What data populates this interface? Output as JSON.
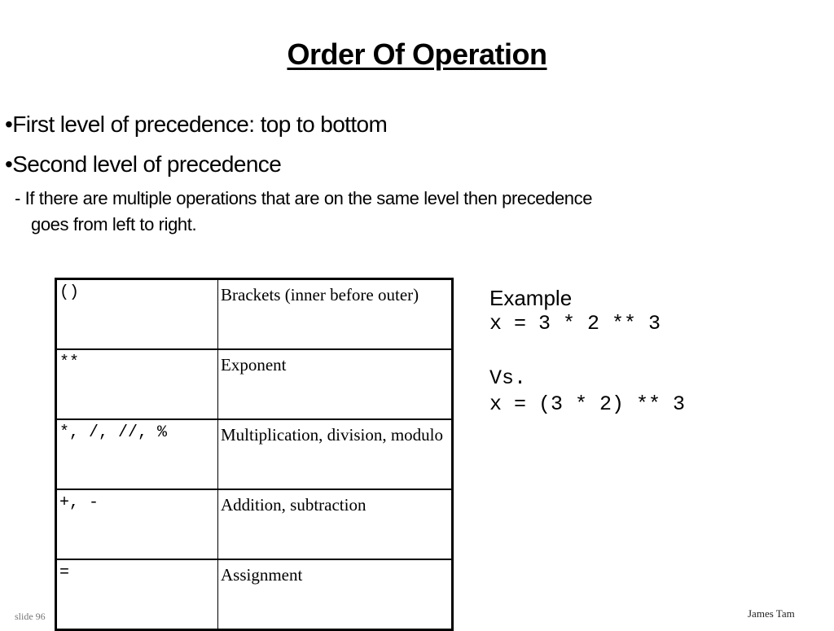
{
  "slide": {
    "title": "Order Of Operation",
    "bullets": [
      "•First level of precedence: top to bottom",
      "•Second level of precedence"
    ],
    "sub_bullet": {
      "line1": "- If there are multiple operations that are on the same level then precedence",
      "line2": "goes from left to right."
    }
  },
  "precedence_table": {
    "rows": [
      {
        "operator": "()",
        "description": "Brackets (inner before outer)"
      },
      {
        "operator": "**",
        "description": "Exponent"
      },
      {
        "operator": "*, /, //, %",
        "description": "Multiplication, division, modulo"
      },
      {
        "operator": "+, -",
        "description": "Addition, subtraction"
      },
      {
        "operator": "=",
        "description": "Assignment"
      }
    ]
  },
  "example": {
    "label": "Example",
    "expr1": "x = 3 * 2 ** 3",
    "vs_label": "Vs.",
    "expr2": "x = (3 * 2) ** 3"
  },
  "footer": {
    "slide_number": "slide 96",
    "author": "James Tam"
  }
}
